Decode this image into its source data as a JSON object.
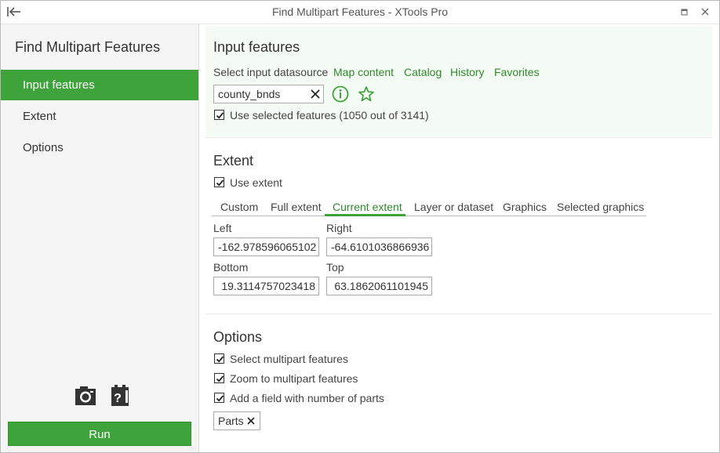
{
  "window": {
    "title": "Find Multipart Features - XTools Pro"
  },
  "sidebar": {
    "title": "Find Multipart Features",
    "items": [
      {
        "label": "Input features",
        "active": true
      },
      {
        "label": "Extent",
        "active": false
      },
      {
        "label": "Options",
        "active": false
      }
    ],
    "run_label": "Run"
  },
  "input_features": {
    "title": "Input features",
    "datasource_label": "Select input datasource",
    "sources": [
      "Map content",
      "Catalog",
      "History",
      "Favorites"
    ],
    "layer_value": "county_bnds",
    "use_selected_label": "Use selected features (1050 out of 3141)",
    "use_selected_checked": true
  },
  "extent": {
    "title": "Extent",
    "use_extent_label": "Use extent",
    "use_extent_checked": true,
    "tabs": [
      "Custom",
      "Full extent",
      "Current extent",
      "Layer or dataset",
      "Graphics",
      "Selected graphics"
    ],
    "active_tab": "Current extent",
    "left_label": "Left",
    "left_value": "-162.978596065102",
    "right_label": "Right",
    "right_value": "-64.6101036866936",
    "bottom_label": "Bottom",
    "bottom_value": "19.3114757023418",
    "top_label": "Top",
    "top_value": "63.1862061101945"
  },
  "options": {
    "title": "Options",
    "select_label": "Select multipart features",
    "zoom_label": "Zoom to multipart features",
    "add_field_label": "Add a field with number of parts",
    "field_name": "Parts"
  },
  "colors": {
    "accent": "#3ea33a",
    "link": "#2f8a2a",
    "section_bg": "#f4fbf4"
  },
  "icons": {
    "back": "collapse-left-icon",
    "info": "info-icon",
    "favorite": "star-icon",
    "clear": "close-icon",
    "snapshot": "camera-icon",
    "help": "clipboard-help-icon"
  }
}
